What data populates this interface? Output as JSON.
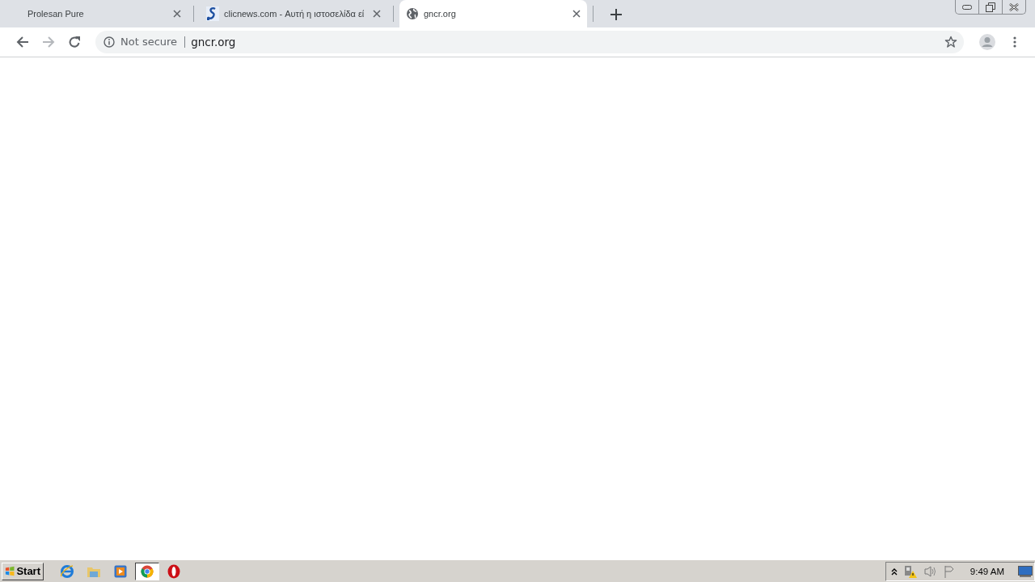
{
  "tabs": [
    {
      "title": "Prolesan Pure",
      "kind": "plain",
      "selected": false
    },
    {
      "title": "clicnews.com - Αυτή η ιστοσελίδα εί",
      "kind": "site",
      "selected": false
    },
    {
      "title": "gncr.org",
      "kind": "web",
      "selected": true
    }
  ],
  "address_bar": {
    "security": "Not secure",
    "url": "gncr.org"
  },
  "taskbar": {
    "start": "Start",
    "apps": [
      {
        "kind": "ie",
        "selected": false
      },
      {
        "kind": "folder",
        "selected": false
      },
      {
        "kind": "media",
        "selected": false
      },
      {
        "kind": "chrome",
        "selected": true
      },
      {
        "kind": "opera",
        "selected": false
      }
    ],
    "clock": "9:49 AM"
  }
}
